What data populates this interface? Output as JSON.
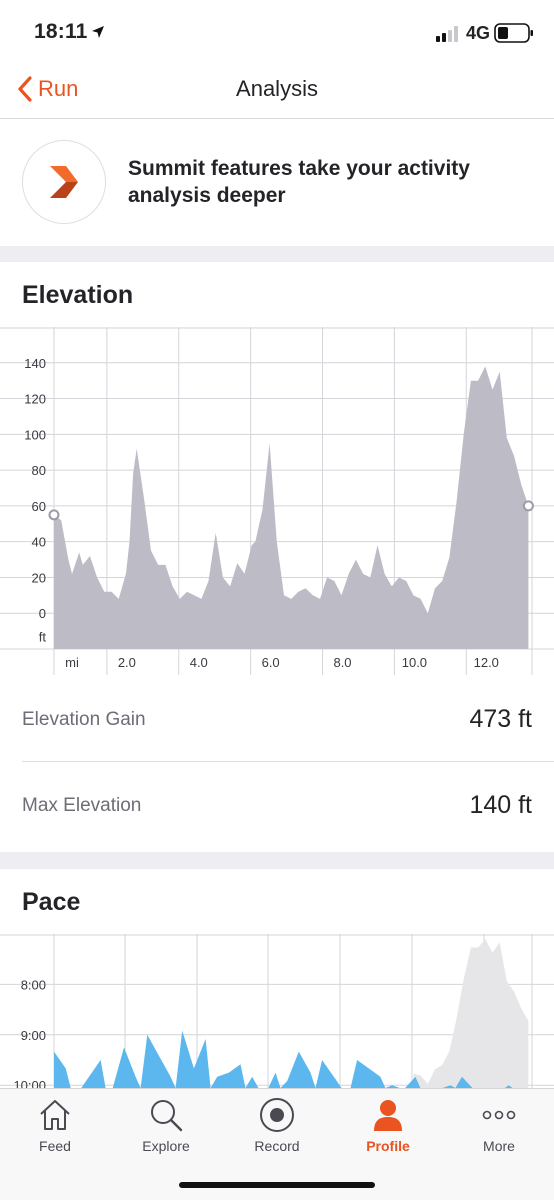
{
  "status": {
    "time": "18:11",
    "network": "4G"
  },
  "nav": {
    "back_label": "Run",
    "title": "Analysis"
  },
  "summit": {
    "text": "Summit features take your activity analysis deeper"
  },
  "elevation": {
    "title": "Elevation",
    "y_ticks": [
      "140",
      "120",
      "100",
      "80",
      "60",
      "40",
      "20",
      "0"
    ],
    "y_unit": "ft",
    "x_unit": "mi",
    "x_ticks": [
      "2.0",
      "4.0",
      "6.0",
      "8.0",
      "10.0",
      "12.0"
    ],
    "gain_label": "Elevation Gain",
    "gain_value": "473 ft",
    "max_label": "Max Elevation",
    "max_value": "140 ft"
  },
  "pace": {
    "title": "Pace",
    "y_ticks": [
      "8:00",
      "9:00",
      "10:00"
    ]
  },
  "chart_data": [
    {
      "type": "area",
      "title": "Elevation",
      "xlabel": "mi",
      "ylabel": "ft",
      "xlim": [
        0,
        13.3
      ],
      "ylim": [
        -20,
        160
      ],
      "x": [
        0.0,
        0.2,
        0.4,
        0.5,
        0.7,
        0.8,
        1.0,
        1.2,
        1.4,
        1.6,
        1.8,
        2.0,
        2.1,
        2.2,
        2.3,
        2.5,
        2.7,
        2.9,
        3.1,
        3.3,
        3.5,
        3.7,
        3.9,
        4.1,
        4.3,
        4.5,
        4.7,
        4.9,
        5.1,
        5.3,
        5.5,
        5.6,
        5.8,
        6.0,
        6.2,
        6.4,
        6.6,
        6.8,
        7.0,
        7.2,
        7.4,
        7.6,
        7.8,
        8.0,
        8.2,
        8.4,
        8.6,
        8.8,
        9.0,
        9.2,
        9.4,
        9.6,
        9.8,
        10.0,
        10.2,
        10.4,
        10.6,
        10.8,
        11.0,
        11.2,
        11.4,
        11.6,
        11.8,
        12.0,
        12.2,
        12.4,
        12.6,
        12.8,
        13.0,
        13.2
      ],
      "y": [
        55,
        52,
        30,
        22,
        34,
        27,
        32,
        20,
        12,
        12,
        8,
        22,
        40,
        78,
        92,
        65,
        35,
        27,
        27,
        15,
        8,
        12,
        10,
        8,
        18,
        45,
        20,
        15,
        28,
        22,
        38,
        40,
        58,
        95,
        40,
        10,
        8,
        12,
        14,
        10,
        8,
        20,
        18,
        10,
        22,
        30,
        22,
        20,
        38,
        22,
        15,
        20,
        18,
        10,
        8,
        0,
        14,
        18,
        31,
        62,
        100,
        130,
        130,
        138,
        125,
        135,
        98,
        88,
        72,
        60
      ]
    },
    {
      "type": "area",
      "title": "Pace",
      "ylim": [
        "10:20",
        "7:00"
      ],
      "y_ticks": [
        "8:00",
        "9:00",
        "10:00"
      ],
      "note": "truncated by tab bar; values shown are visible peaks in min/mi",
      "y": [
        "9:20",
        "9:40",
        "10:10",
        "9:50",
        "9:30",
        "10:05",
        "9:15",
        "9:50",
        "9:00",
        "9:25",
        "9:50",
        "8:55",
        "9:40",
        "9:05",
        "9:50",
        "9:45",
        "9:35",
        "9:50",
        "10:15",
        "9:45",
        "9:55",
        "9:20",
        "9:45",
        "9:30",
        "9:50",
        "10:10",
        "9:30",
        "9:40",
        "9:50",
        "10:00",
        "10:05",
        "9:50",
        "10:10",
        "10:05",
        "10:00",
        "9:50",
        "10:05",
        "10:15",
        "10:10",
        "10:00",
        "10:10",
        "10:05"
      ]
    }
  ]
}
